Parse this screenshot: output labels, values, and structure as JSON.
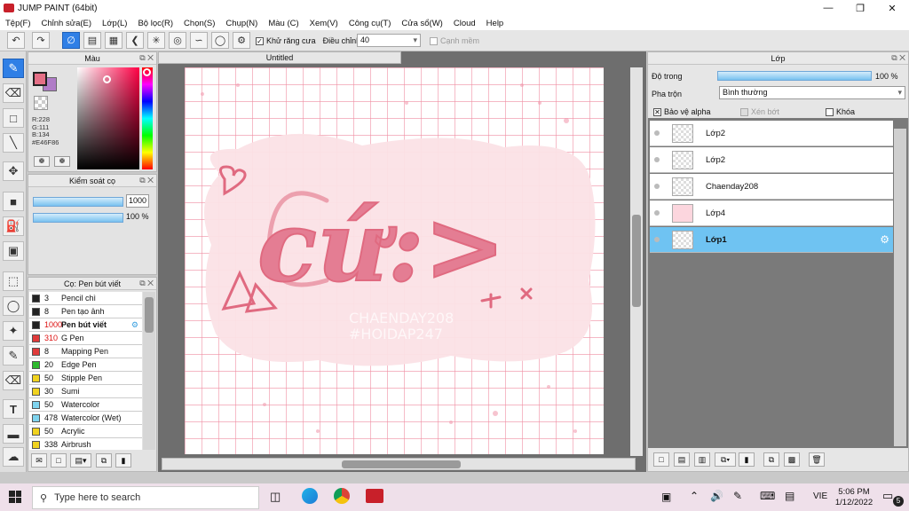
{
  "window": {
    "title": "JUMP PAINT (64bit)"
  },
  "menu": [
    "Tệp(F)",
    "Chỉnh sửa(E)",
    "Lớp(L)",
    "Bộ lọc(R)",
    "Chọn(S)",
    "Chụp(N)",
    "Màu (C)",
    "Xem(V)",
    "Công cụ(T)",
    "Cửa sổ(W)",
    "Cloud",
    "Help"
  ],
  "toolbar": {
    "antialias_label": "Khử răng cưa",
    "adjust_label": "Điều chỉnh",
    "adjust_value": "40",
    "snap_label": "Cạnh mềm"
  },
  "color_panel": {
    "title": "Màu",
    "r": "R:228",
    "g": "G:111",
    "b": "B:134",
    "hex": "#E46F86",
    "fg": "#E46F86",
    "bg": "#b07cc7"
  },
  "brush_control": {
    "title": "Kiểm soát cọ",
    "size": "1000",
    "opacity": "100 %",
    "opacity_fraction": 1.0
  },
  "brush_list": {
    "title": "Cọ: Pen bút viết",
    "items": [
      {
        "size": "3",
        "name": "Pencil chì",
        "color": "#222222"
      },
      {
        "size": "8",
        "name": "Pen tạo ảnh",
        "color": "#222222"
      },
      {
        "size": "1000",
        "name": "Pen bút viết",
        "color": "#222222",
        "selected": true
      },
      {
        "size": "310",
        "name": "G Pen",
        "color": "#e03a3a"
      },
      {
        "size": "8",
        "name": "Mapping Pen",
        "color": "#e03a3a"
      },
      {
        "size": "20",
        "name": "Edge Pen",
        "color": "#2db82d"
      },
      {
        "size": "50",
        "name": "Stipple Pen",
        "color": "#f0d21e"
      },
      {
        "size": "30",
        "name": "Sumi",
        "color": "#f0d21e"
      },
      {
        "size": "50",
        "name": "Watercolor",
        "color": "#7fd4ef"
      },
      {
        "size": "478",
        "name": "Watercolor (Wet)",
        "color": "#7fd4ef"
      },
      {
        "size": "50",
        "name": "Acrylic",
        "color": "#f0d21e"
      },
      {
        "size": "338",
        "name": "Airbrush",
        "color": "#f0d21e"
      }
    ]
  },
  "document": {
    "tab": "Untitled",
    "artwork_text": "cứ:>",
    "watermark1": "CHAENDAY208",
    "watermark2": "#HOIDAP247"
  },
  "layers": {
    "title": "Lớp",
    "opacity_label": "Độ trong",
    "opacity_value": "100 %",
    "opacity_fraction": 1.0,
    "blend_label": "Pha trộn",
    "blend_value": "Bình thường",
    "protect_alpha": "Bảo vệ alpha",
    "clip": "Xén bớt",
    "lock": "Khóa",
    "items": [
      {
        "name": "Lớp2"
      },
      {
        "name": "Lớp2"
      },
      {
        "name": "Chaenday208"
      },
      {
        "name": "Lớp4"
      },
      {
        "name": "Lớp1",
        "selected": true
      }
    ]
  },
  "taskbar": {
    "search_placeholder": "Type here to search",
    "lang": "VIE",
    "time": "5:06 PM",
    "date": "1/12/2022",
    "notif_count": "5"
  }
}
